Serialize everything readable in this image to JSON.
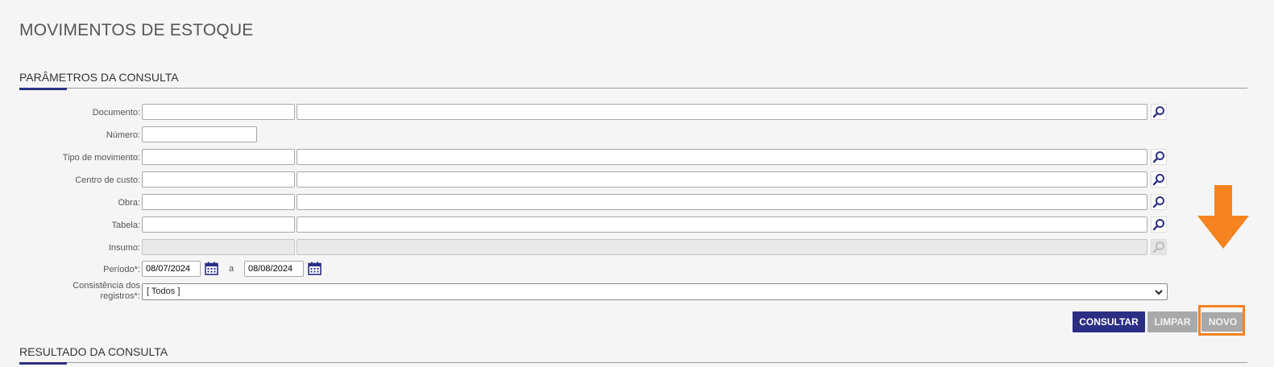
{
  "page": {
    "title": "MOVIMENTOS DE ESTOQUE"
  },
  "sections": {
    "params_title": "PARÂMETROS DA CONSULTA",
    "results_title": "RESULTADO DA CONSULTA"
  },
  "form": {
    "documento_label": "Documento:",
    "numero_label": "Número:",
    "tipo_label": "Tipo de movimento:",
    "centro_label": "Centro de custo:",
    "obra_label": "Obra:",
    "tabela_label": "Tabela:",
    "insumo_label": "Insumo:",
    "periodo_label": "Período*:",
    "periodo_from": "08/07/2024",
    "periodo_sep": "a",
    "periodo_to": "08/08/2024",
    "consistencia_label_1": "Consistência dos",
    "consistencia_label_2": "registros*:",
    "consistencia_value": "[ Todos ]"
  },
  "buttons": {
    "consultar": "CONSULTAR",
    "limpar": "LIMPAR",
    "novo": "NOVO"
  },
  "colors": {
    "primary": "#2b2f83",
    "highlight": "#f58320",
    "disabled_button": "#a9a9a9"
  },
  "icons": {
    "lookup": "magnifier-icon",
    "calendar": "calendar-icon",
    "dropdown": "chevron-down-icon",
    "annotation": "arrow-down-icon"
  }
}
